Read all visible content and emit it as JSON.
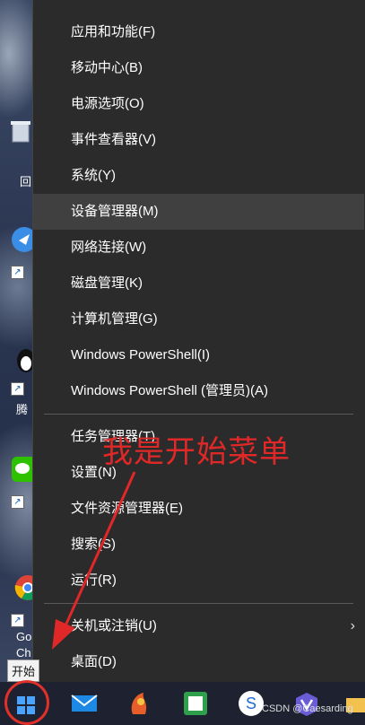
{
  "menu": {
    "items": [
      {
        "label": "应用和功能(F)"
      },
      {
        "label": "移动中心(B)"
      },
      {
        "label": "电源选项(O)"
      },
      {
        "label": "事件查看器(V)"
      },
      {
        "label": "系统(Y)"
      },
      {
        "label": "设备管理器(M)",
        "highlighted": true
      },
      {
        "label": "网络连接(W)"
      },
      {
        "label": "磁盘管理(K)"
      },
      {
        "label": "计算机管理(G)"
      },
      {
        "label": "Windows PowerShell(I)"
      },
      {
        "label": "Windows PowerShell (管理员)(A)"
      },
      {
        "label": "任务管理器(T)"
      },
      {
        "label": "设置(N)"
      },
      {
        "label": "文件资源管理器(E)"
      },
      {
        "label": "搜索(S)"
      },
      {
        "label": "运行(R)"
      },
      {
        "label": "关机或注销(U)",
        "submenu": true
      },
      {
        "label": "桌面(D)"
      }
    ]
  },
  "annotation": "我是开始菜单",
  "start_tooltip": "开始",
  "watermark": "CSDN @Caesarding",
  "desktop": {
    "labels": [
      "回",
      "腾",
      "Go",
      "Ch"
    ]
  },
  "taskbar": {
    "icons": [
      "windows-start-icon",
      "mail-icon",
      "photos-icon",
      "whiteboard-icon",
      "sogou-browser-icon",
      "notes-icon",
      "file-explorer-icon"
    ]
  },
  "colors": {
    "menu_bg": "#2b2b2b",
    "highlight_bg": "#404040",
    "annotation": "#e02828",
    "start_circle": "#e0302a"
  }
}
